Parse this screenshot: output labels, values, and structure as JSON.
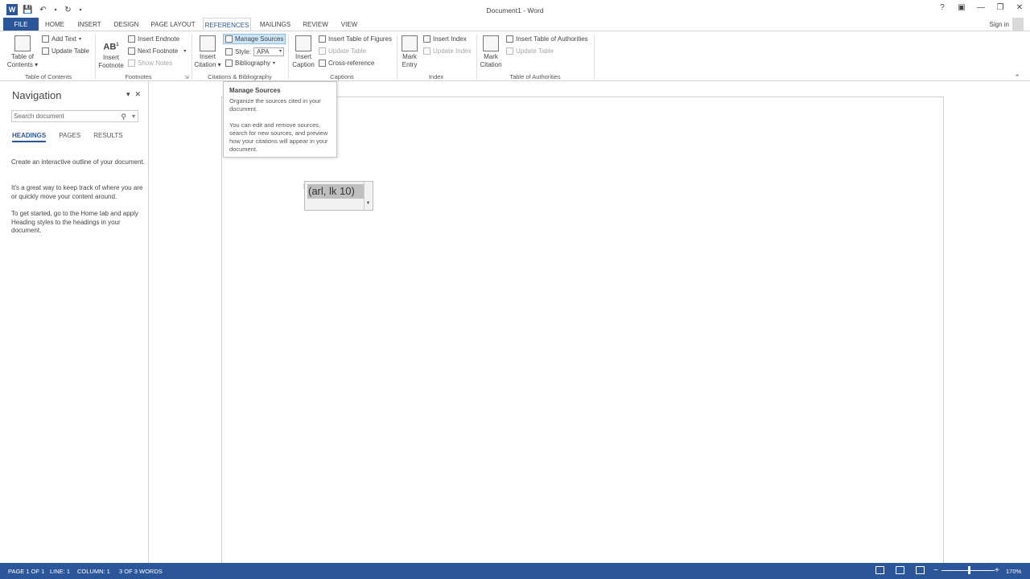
{
  "title_bar": {
    "title": "Document1 - Word",
    "signin": "Sign in",
    "help": "?"
  },
  "tabs": [
    "FILE",
    "HOME",
    "INSERT",
    "DESIGN",
    "PAGE LAYOUT",
    "REFERENCES",
    "MAILINGS",
    "REVIEW",
    "VIEW"
  ],
  "active_tab": "REFERENCES",
  "ribbon": {
    "toc": {
      "big_label_1": "Table of",
      "big_label_2": "Contents",
      "add_text": "Add Text",
      "update_table": "Update Table",
      "group": "Table of Contents"
    },
    "footnotes": {
      "insert_label_1": "Insert",
      "insert_label_2": "Footnote",
      "insert_endnote": "Insert Endnote",
      "next_footnote": "Next Footnote",
      "show_notes": "Show Notes",
      "group": "Footnotes"
    },
    "citations": {
      "insert_label_1": "Insert",
      "insert_label_2": "Citation",
      "manage_sources": "Manage Sources",
      "style_label": "Style:",
      "style_value": "APA",
      "bibliography": "Bibliography",
      "group": "Citations & Bibliography"
    },
    "captions": {
      "insert_label_1": "Insert",
      "insert_label_2": "Caption",
      "insert_table_of_figures": "Insert Table of Figures",
      "update_table": "Update Table",
      "cross_reference": "Cross-reference",
      "group": "Captions"
    },
    "index": {
      "mark_label_1": "Mark",
      "mark_label_2": "Entry",
      "insert_index": "Insert Index",
      "update_index": "Update Index",
      "group": "Index"
    },
    "authorities": {
      "mark_label_1": "Mark",
      "mark_label_2": "Citation",
      "insert_table": "Insert Table of Authorities",
      "update_table": "Update Table",
      "group": "Table of Authorities"
    }
  },
  "tooltip": {
    "title": "Manage Sources",
    "para1": "Organize the sources cited in your document.",
    "para2": "You can edit and remove sources, search for new sources, and preview how your citations will appear in your document."
  },
  "navigation": {
    "title": "Navigation",
    "search_placeholder": "Search document",
    "tabs": [
      "HEADINGS",
      "PAGES",
      "RESULTS"
    ],
    "text1": "Create an interactive outline of your document.",
    "text2": "It's a great way to keep track of where you are or quickly move your content around.",
    "text3": "To get started, go to the Home tab and apply Heading styles to the headings in your document."
  },
  "document": {
    "citation_text": "(arl, lk 10)"
  },
  "status_bar": {
    "page": "PAGE 1 OF 1",
    "line": "LINE: 1",
    "column": "COLUMN: 1",
    "words": "3 OF 3 WORDS",
    "zoom": "170%"
  },
  "colors": {
    "accent": "#2b579a",
    "highlight": "#cde6f7"
  }
}
